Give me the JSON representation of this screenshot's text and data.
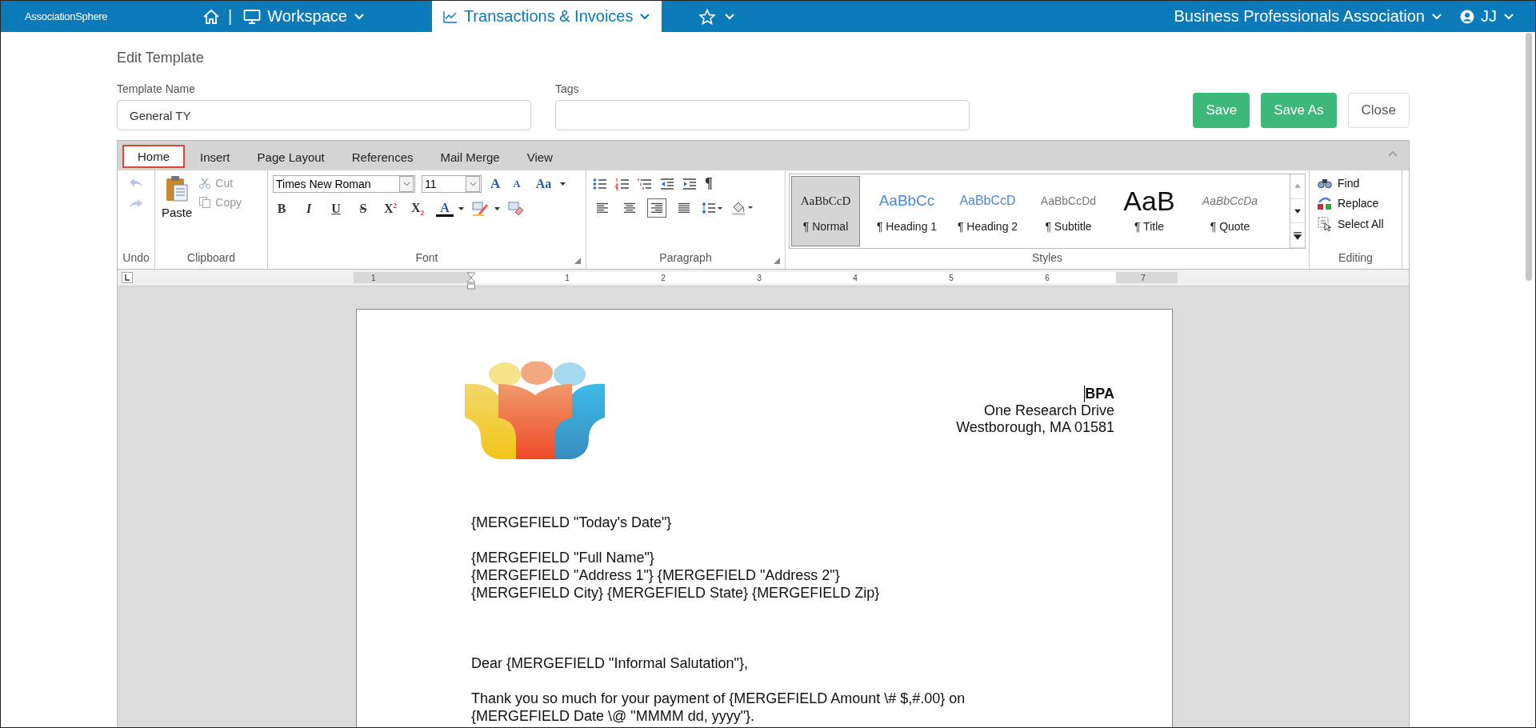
{
  "nav": {
    "logo": "AssociationSphere",
    "separator": "|",
    "tabs": [
      {
        "label": "Workspace",
        "selected": false
      },
      {
        "label": "Transactions & Invoices",
        "selected": true
      }
    ],
    "org": "Business Professionals Association",
    "user": "JJ"
  },
  "form": {
    "title": "Edit Template",
    "name_label": "Template Name",
    "name_value": "General TY",
    "tags_label": "Tags",
    "buttons": [
      {
        "label": "Save",
        "kind": "primary"
      },
      {
        "label": "Save As",
        "kind": "primary"
      },
      {
        "label": "Close",
        "kind": "plain"
      }
    ]
  },
  "ribbon": {
    "tabs": [
      {
        "label": "Home",
        "selected": true
      },
      {
        "label": "Insert",
        "selected": false
      },
      {
        "label": "Page Layout",
        "selected": false
      },
      {
        "label": "References",
        "selected": false
      },
      {
        "label": "Mail Merge",
        "selected": false
      },
      {
        "label": "View",
        "selected": false
      }
    ],
    "undo": {
      "label": "Undo",
      "undo_disabled": true,
      "redo_disabled": true
    },
    "clipboard": {
      "label": "Clipboard",
      "paste": "Paste",
      "cut": "Cut",
      "copy": "Copy",
      "cut_disabled": true,
      "copy_disabled": true
    },
    "font": {
      "label": "Font",
      "name": "Times New Roman",
      "size": "11",
      "grow": "A",
      "shrink": "A",
      "change_case": "Aa",
      "formats": [
        "B",
        "I",
        "U",
        "S",
        "X$^{2}$",
        "X$_{2}$"
      ],
      "color_letter": "A"
    },
    "paragraph": {
      "label": "Paragraph",
      "marks": "¶",
      "align": [
        {
          "kind": "left",
          "selected": false
        },
        {
          "kind": "center",
          "selected": false
        },
        {
          "kind": "right",
          "selected": true
        },
        {
          "kind": "justify",
          "selected": false
        }
      ]
    },
    "styles": {
      "label": "Styles",
      "items": [
        {
          "preview": "AaBbCcD",
          "label": "¶ Normal",
          "kind": "normal",
          "selected": true
        },
        {
          "preview": "AaBbCc",
          "label": "¶ Heading 1",
          "kind": "h1",
          "selected": false
        },
        {
          "preview": "AaBbCcD",
          "label": "¶ Heading 2",
          "kind": "h2",
          "selected": false
        },
        {
          "preview": "AaBbCcDd",
          "label": "¶ Subtitle",
          "kind": "subtitle",
          "selected": false
        },
        {
          "preview": "AaB",
          "label": "¶ Title",
          "kind": "title",
          "selected": false
        },
        {
          "preview": "AaBbCcDa",
          "label": "¶ Quote",
          "kind": "quote",
          "selected": false
        }
      ]
    },
    "editing": {
      "label": "Editing",
      "find": "Find",
      "replace": "Replace",
      "select_all": "Select All"
    }
  },
  "ruler": [
    "1",
    "1",
    "2",
    "3",
    "4",
    "5",
    "6",
    "7"
  ],
  "document": {
    "org": "BPA",
    "address": [
      "One Research Drive",
      "Westborough, MA 01581"
    ],
    "paragraphs": [
      [
        "{MERGEFIELD \"Today's Date\"}"
      ],
      [
        "{MERGEFIELD \"Full Name\"}",
        "{MERGEFIELD \"Address 1\"} {MERGEFIELD \"Address 2\"}",
        "{MERGEFIELD City} {MERGEFIELD State} {MERGEFIELD Zip}"
      ],
      [
        "Dear {MERGEFIELD \"Informal Salutation\"},"
      ],
      [
        "Thank you so much for your payment of {MERGEFIELD Amount \\# $,#.00} on",
        "{MERGEFIELD Date \\@ \"MMMM dd, yyyy\"}."
      ]
    ]
  }
}
